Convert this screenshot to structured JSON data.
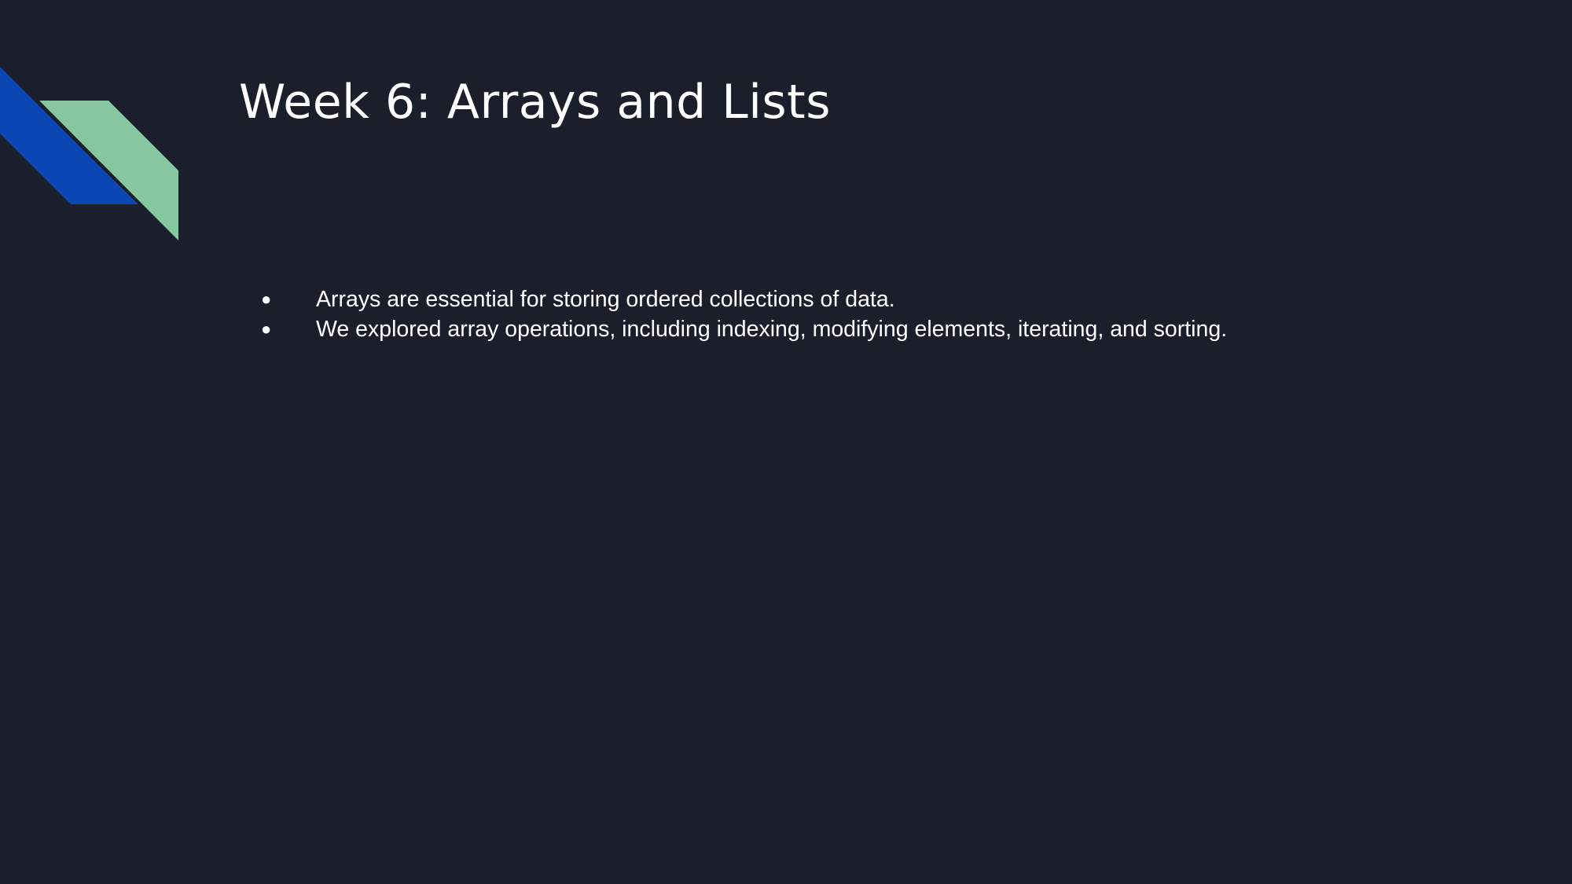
{
  "slide": {
    "title": "Week 6: Arrays and Lists",
    "bullets": [
      "Arrays are essential for storing ordered collections of data.",
      "We explored array operations, including indexing, modifying elements, iterating, and sorting."
    ],
    "bullet_glyph": "●"
  },
  "colors": {
    "background": "#1b1f2b",
    "accent_blue": "#0a46b4",
    "accent_green": "#86c7a0",
    "text": "#ffffff"
  }
}
